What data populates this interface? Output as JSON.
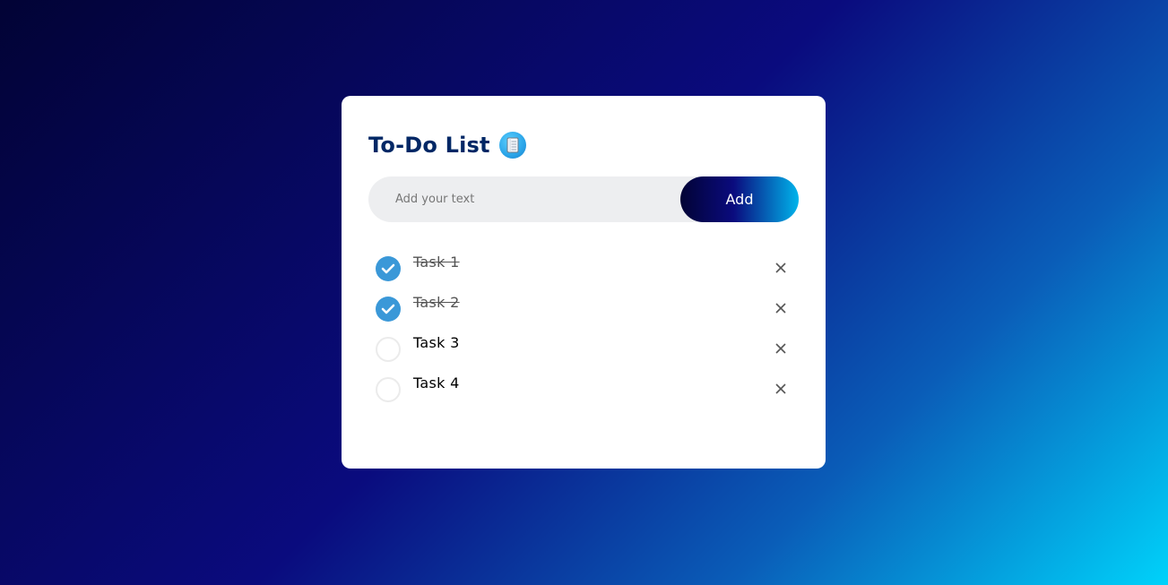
{
  "app": {
    "title": "To-Do List",
    "title_icon": "notepad-icon"
  },
  "input": {
    "placeholder": "Add your text",
    "value": "",
    "button_label": "Add"
  },
  "tasks": [
    {
      "label": "Task 1",
      "checked": true
    },
    {
      "label": "Task 2",
      "checked": true
    },
    {
      "label": "Task 3",
      "checked": false
    },
    {
      "label": "Task 4",
      "checked": false
    }
  ],
  "icons": {
    "check": "check-icon",
    "remove": "close-icon"
  },
  "colors": {
    "title": "#002765",
    "checked_circle": "#3a98d8",
    "button_gradient_start": "#020335",
    "button_gradient_end": "#00b4eb",
    "background_start": "#020335",
    "background_end": "#00d2fa"
  }
}
